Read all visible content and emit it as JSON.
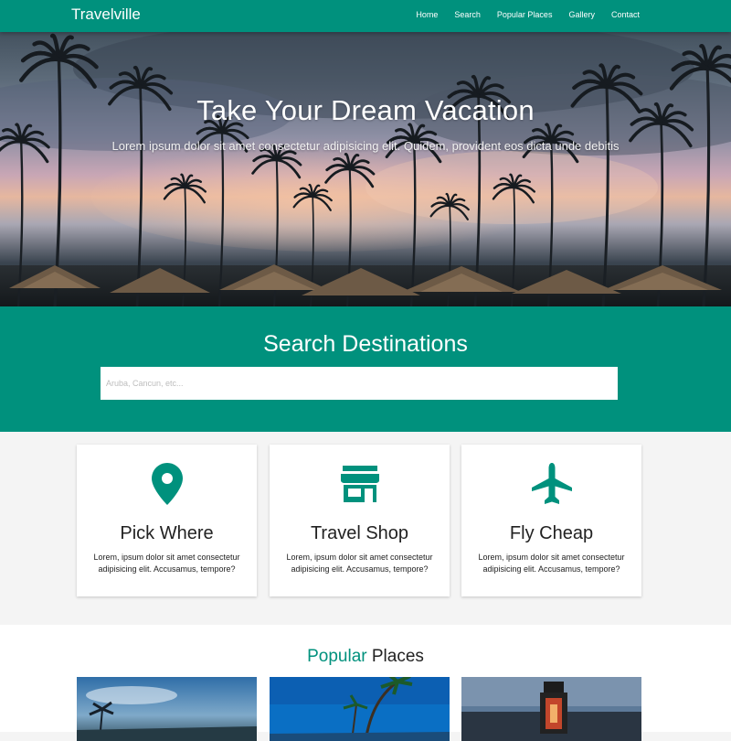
{
  "brand": "Travelville",
  "nav": {
    "items": [
      {
        "label": "Home"
      },
      {
        "label": "Search"
      },
      {
        "label": "Popular Places"
      },
      {
        "label": "Gallery"
      },
      {
        "label": "Contact"
      }
    ]
  },
  "hero": {
    "title": "Take Your Dream Vacation",
    "subtitle": "Lorem ipsum dolor sit amet consectetur adipisicing elit. Quidem, provident eos dicta unde debitis"
  },
  "search": {
    "title": "Search Destinations",
    "placeholder": "Aruba, Cancun, etc..."
  },
  "features": [
    {
      "icon": "map-marker-icon",
      "title": "Pick Where",
      "text": "Lorem, ipsum dolor sit amet consectetur adipisicing elit. Accusamus, tempore?"
    },
    {
      "icon": "store-icon",
      "title": "Travel Shop",
      "text": "Lorem, ipsum dolor sit amet consectetur adipisicing elit. Accusamus, tempore?"
    },
    {
      "icon": "plane-icon",
      "title": "Fly Cheap",
      "text": "Lorem, ipsum dolor sit amet consectetur adipisicing elit. Accusamus, tempore?"
    }
  ],
  "popular": {
    "title_accent": "Popular",
    "title_rest": " Places"
  },
  "colors": {
    "brand": "#00917d",
    "background": "#f4f4f4"
  }
}
